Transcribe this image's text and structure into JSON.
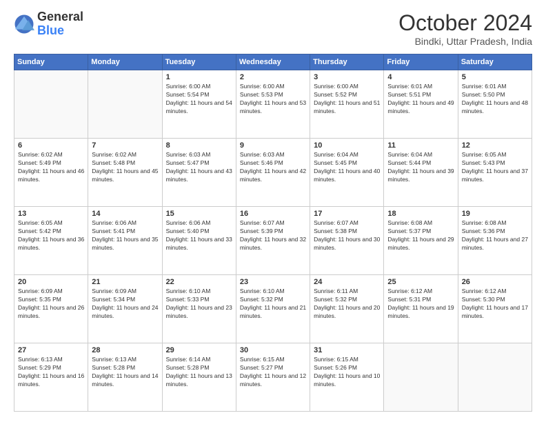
{
  "header": {
    "logo_general": "General",
    "logo_blue": "Blue",
    "month_title": "October 2024",
    "location": "Bindki, Uttar Pradesh, India"
  },
  "weekdays": [
    "Sunday",
    "Monday",
    "Tuesday",
    "Wednesday",
    "Thursday",
    "Friday",
    "Saturday"
  ],
  "weeks": [
    [
      {
        "day": "",
        "empty": true
      },
      {
        "day": "",
        "empty": true
      },
      {
        "day": "1",
        "sunrise": "6:00 AM",
        "sunset": "5:54 PM",
        "daylight": "11 hours and 54 minutes."
      },
      {
        "day": "2",
        "sunrise": "6:00 AM",
        "sunset": "5:53 PM",
        "daylight": "11 hours and 53 minutes."
      },
      {
        "day": "3",
        "sunrise": "6:00 AM",
        "sunset": "5:52 PM",
        "daylight": "11 hours and 51 minutes."
      },
      {
        "day": "4",
        "sunrise": "6:01 AM",
        "sunset": "5:51 PM",
        "daylight": "11 hours and 49 minutes."
      },
      {
        "day": "5",
        "sunrise": "6:01 AM",
        "sunset": "5:50 PM",
        "daylight": "11 hours and 48 minutes."
      }
    ],
    [
      {
        "day": "6",
        "sunrise": "6:02 AM",
        "sunset": "5:49 PM",
        "daylight": "11 hours and 46 minutes."
      },
      {
        "day": "7",
        "sunrise": "6:02 AM",
        "sunset": "5:48 PM",
        "daylight": "11 hours and 45 minutes."
      },
      {
        "day": "8",
        "sunrise": "6:03 AM",
        "sunset": "5:47 PM",
        "daylight": "11 hours and 43 minutes."
      },
      {
        "day": "9",
        "sunrise": "6:03 AM",
        "sunset": "5:46 PM",
        "daylight": "11 hours and 42 minutes."
      },
      {
        "day": "10",
        "sunrise": "6:04 AM",
        "sunset": "5:45 PM",
        "daylight": "11 hours and 40 minutes."
      },
      {
        "day": "11",
        "sunrise": "6:04 AM",
        "sunset": "5:44 PM",
        "daylight": "11 hours and 39 minutes."
      },
      {
        "day": "12",
        "sunrise": "6:05 AM",
        "sunset": "5:43 PM",
        "daylight": "11 hours and 37 minutes."
      }
    ],
    [
      {
        "day": "13",
        "sunrise": "6:05 AM",
        "sunset": "5:42 PM",
        "daylight": "11 hours and 36 minutes."
      },
      {
        "day": "14",
        "sunrise": "6:06 AM",
        "sunset": "5:41 PM",
        "daylight": "11 hours and 35 minutes."
      },
      {
        "day": "15",
        "sunrise": "6:06 AM",
        "sunset": "5:40 PM",
        "daylight": "11 hours and 33 minutes."
      },
      {
        "day": "16",
        "sunrise": "6:07 AM",
        "sunset": "5:39 PM",
        "daylight": "11 hours and 32 minutes."
      },
      {
        "day": "17",
        "sunrise": "6:07 AM",
        "sunset": "5:38 PM",
        "daylight": "11 hours and 30 minutes."
      },
      {
        "day": "18",
        "sunrise": "6:08 AM",
        "sunset": "5:37 PM",
        "daylight": "11 hours and 29 minutes."
      },
      {
        "day": "19",
        "sunrise": "6:08 AM",
        "sunset": "5:36 PM",
        "daylight": "11 hours and 27 minutes."
      }
    ],
    [
      {
        "day": "20",
        "sunrise": "6:09 AM",
        "sunset": "5:35 PM",
        "daylight": "11 hours and 26 minutes."
      },
      {
        "day": "21",
        "sunrise": "6:09 AM",
        "sunset": "5:34 PM",
        "daylight": "11 hours and 24 minutes."
      },
      {
        "day": "22",
        "sunrise": "6:10 AM",
        "sunset": "5:33 PM",
        "daylight": "11 hours and 23 minutes."
      },
      {
        "day": "23",
        "sunrise": "6:10 AM",
        "sunset": "5:32 PM",
        "daylight": "11 hours and 21 minutes."
      },
      {
        "day": "24",
        "sunrise": "6:11 AM",
        "sunset": "5:32 PM",
        "daylight": "11 hours and 20 minutes."
      },
      {
        "day": "25",
        "sunrise": "6:12 AM",
        "sunset": "5:31 PM",
        "daylight": "11 hours and 19 minutes."
      },
      {
        "day": "26",
        "sunrise": "6:12 AM",
        "sunset": "5:30 PM",
        "daylight": "11 hours and 17 minutes."
      }
    ],
    [
      {
        "day": "27",
        "sunrise": "6:13 AM",
        "sunset": "5:29 PM",
        "daylight": "11 hours and 16 minutes."
      },
      {
        "day": "28",
        "sunrise": "6:13 AM",
        "sunset": "5:28 PM",
        "daylight": "11 hours and 14 minutes."
      },
      {
        "day": "29",
        "sunrise": "6:14 AM",
        "sunset": "5:28 PM",
        "daylight": "11 hours and 13 minutes."
      },
      {
        "day": "30",
        "sunrise": "6:15 AM",
        "sunset": "5:27 PM",
        "daylight": "11 hours and 12 minutes."
      },
      {
        "day": "31",
        "sunrise": "6:15 AM",
        "sunset": "5:26 PM",
        "daylight": "11 hours and 10 minutes."
      },
      {
        "day": "",
        "empty": true
      },
      {
        "day": "",
        "empty": true
      }
    ]
  ]
}
